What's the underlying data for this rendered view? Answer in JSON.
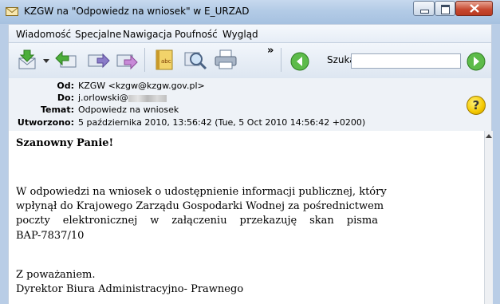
{
  "window": {
    "title": "KZGW na \"Odpowiedz na wniosek\" w E_URZAD"
  },
  "menubar": {
    "items": [
      "Wiadomość",
      "Specjalne",
      "Nawigacja",
      "Poufność",
      "Wygląd"
    ]
  },
  "toolbar": {
    "search_label": "Szukaj:",
    "search_value": "",
    "more_glyph": "»"
  },
  "headers": {
    "from_label": "Od:",
    "from_value": "KZGW <kzgw@kzgw.gov.pl>",
    "to_label": "Do:",
    "to_value": "j.orlowski@",
    "subject_label": "Temat:",
    "subject_value": "Odpowiedz na wniosek",
    "created_label": "Utworzono:",
    "created_value": "5 października 2010, 13:56:42  (Tue, 5 Oct 2010 14:56:42 +0200)"
  },
  "message": {
    "greeting": "Szanowny Panie!",
    "para_lines": [
      "W odpowiedzi na wniosek o udostępnienie informacji publicznej, który",
      "wpłynął do Krajowego Zarządu Gospodarki Wodnej za pośrednictwem",
      "poczty elektronicznej w załączeniu przekazuję skan pisma",
      "BAP-7837/10"
    ],
    "closing": "Z poważaniem.",
    "signature": "Dyrektor Biura Administracyjno- Prawnego"
  },
  "icons": {
    "help_glyph": "?"
  }
}
